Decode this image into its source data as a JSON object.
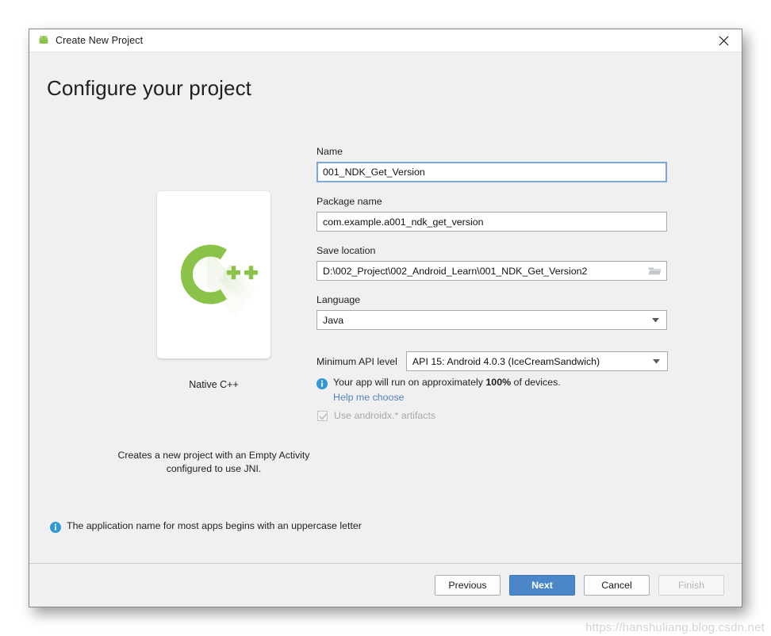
{
  "window": {
    "title": "Create New Project",
    "icon": "android-robot-icon",
    "close_icon": "close-icon"
  },
  "page": {
    "heading": "Configure your project"
  },
  "preview": {
    "template_name": "Native C++",
    "template_icon": "cpp-logo-icon",
    "description": "Creates a new project with an Empty Activity configured to use JNI."
  },
  "form": {
    "name": {
      "label": "Name",
      "value": "001_NDK_Get_Version",
      "placeholder": "Name",
      "focused": true
    },
    "package_name": {
      "label": "Package name",
      "value": "com.example.a001_ndk_get_version",
      "placeholder": "Package name"
    },
    "save_location": {
      "label": "Save location",
      "value": "D:\\002_Project\\002_Android_Learn\\001_NDK_Get_Version2",
      "placeholder": "Save location",
      "browse_icon": "folder-icon"
    },
    "language": {
      "label": "Language",
      "value": "Java",
      "caret_icon": "chevron-down-icon"
    },
    "min_api": {
      "label": "Minimum API level",
      "value": "API 15: Android 4.0.3 (IceCreamSandwich)",
      "caret_icon": "chevron-down-icon"
    },
    "device_info": {
      "icon": "info-icon",
      "prefix": "Your app will run on approximately ",
      "percent": "100%",
      "suffix": " of devices."
    },
    "help_link": "Help me choose",
    "androidx": {
      "label": "Use androidx.* artifacts",
      "checked": true,
      "disabled": true,
      "check_icon": "checkmark-icon"
    }
  },
  "bottom_note": {
    "icon": "info-icon",
    "text": "The application name for most apps begins with an uppercase letter"
  },
  "footer": {
    "previous": "Previous",
    "next": "Next",
    "cancel": "Cancel",
    "finish": "Finish"
  },
  "watermark": "https://hanshuliang.blog.csdn.net",
  "colors": {
    "primary": "#4a86c8",
    "link": "#5581c4",
    "info": "#3399d4",
    "accent_green": "#8bc34a",
    "focus_border": "#7aa8d6",
    "body_bg": "#f0f0f0"
  }
}
